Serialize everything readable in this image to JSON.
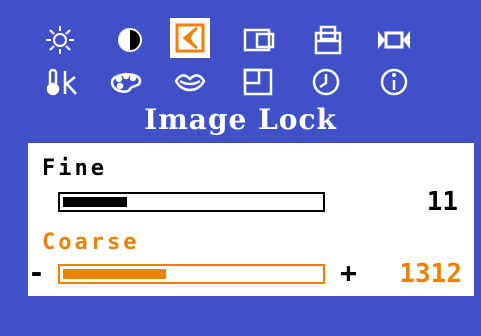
{
  "colors": {
    "background": "#3f50c8",
    "panel": "#ffffff",
    "selected_text": "#f08000",
    "selected_fill": "#f08000",
    "normal_text": "#000000",
    "normal_fill": "#000000"
  },
  "icons": {
    "row1": [
      "brightness-icon",
      "contrast-icon",
      "image-lock-icon",
      "position-icon",
      "size-icon",
      "video-icon"
    ],
    "row2": [
      "color-temperature-icon",
      "color-palette-icon",
      "sharpness-icon",
      "picture-in-picture-icon",
      "timer-icon",
      "information-icon"
    ],
    "selected": "image-lock-icon"
  },
  "menu": {
    "title": "Image Lock"
  },
  "fine": {
    "label": "Fine",
    "value": "11",
    "level": 0.25
  },
  "coarse": {
    "label": "Coarse",
    "value": "1312",
    "level": 0.4,
    "minus": "-",
    "plus": "+"
  }
}
